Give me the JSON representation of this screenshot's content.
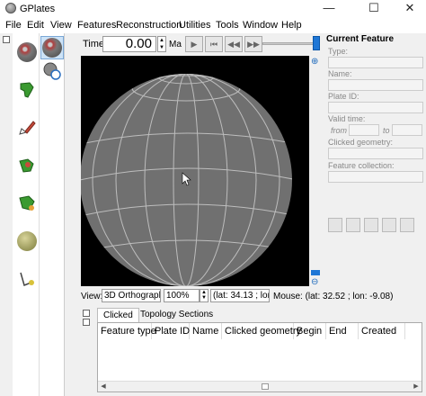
{
  "window": {
    "title": "GPlates",
    "minimize_glyph": "—",
    "maximize_glyph": "☐",
    "close_glyph": "✕"
  },
  "menu": [
    "File",
    "Edit",
    "View",
    "Features",
    "Reconstruction",
    "Utilities",
    "Tools",
    "Window",
    "Help"
  ],
  "time_bar": {
    "label": "Time:",
    "value": "0.00",
    "unit": "Ma",
    "buttons": [
      "▶",
      "⏮",
      "◀◀",
      "▶▶"
    ]
  },
  "view_bar": {
    "view_label": "View:",
    "projection": "3D Orthographi",
    "zoom": "100%",
    "latlon": "(lat: 34.13 ; lon: -1",
    "mouse": "Mouse: (lat: 32.52 ; lon: -9.08)"
  },
  "current_feature": {
    "title": "Current Feature",
    "type_label": "Type:",
    "name_label": "Name:",
    "plate_id_label": "Plate ID:",
    "valid_time_label": "Valid time:",
    "from_label": "from",
    "to_label": "to",
    "clicked_geometry_label": "Clicked geometry:",
    "feature_collection_label": "Feature collection:"
  },
  "bottom_panel": {
    "tabs": [
      "Clicked",
      "Topology Sections"
    ],
    "columns": [
      "Feature type",
      "Plate ID",
      "Name",
      "Clicked geometry",
      "Begin",
      "End",
      "Created"
    ]
  },
  "tools": {
    "column1": [
      "globe-drag-icon",
      "digitise-africa-icon",
      "edit-pencil-icon",
      "move-vertex-icon",
      "insert-vertex-icon",
      "small-circle-icon",
      "measure-icon"
    ],
    "column2": [
      "globe-query-icon",
      "zoom-query-icon"
    ]
  },
  "colors": {
    "canvas_background": "#000000",
    "globe_fill": "#707070",
    "grid_lines": "#bdbdbd",
    "selection_blue": "#1f77d6"
  }
}
